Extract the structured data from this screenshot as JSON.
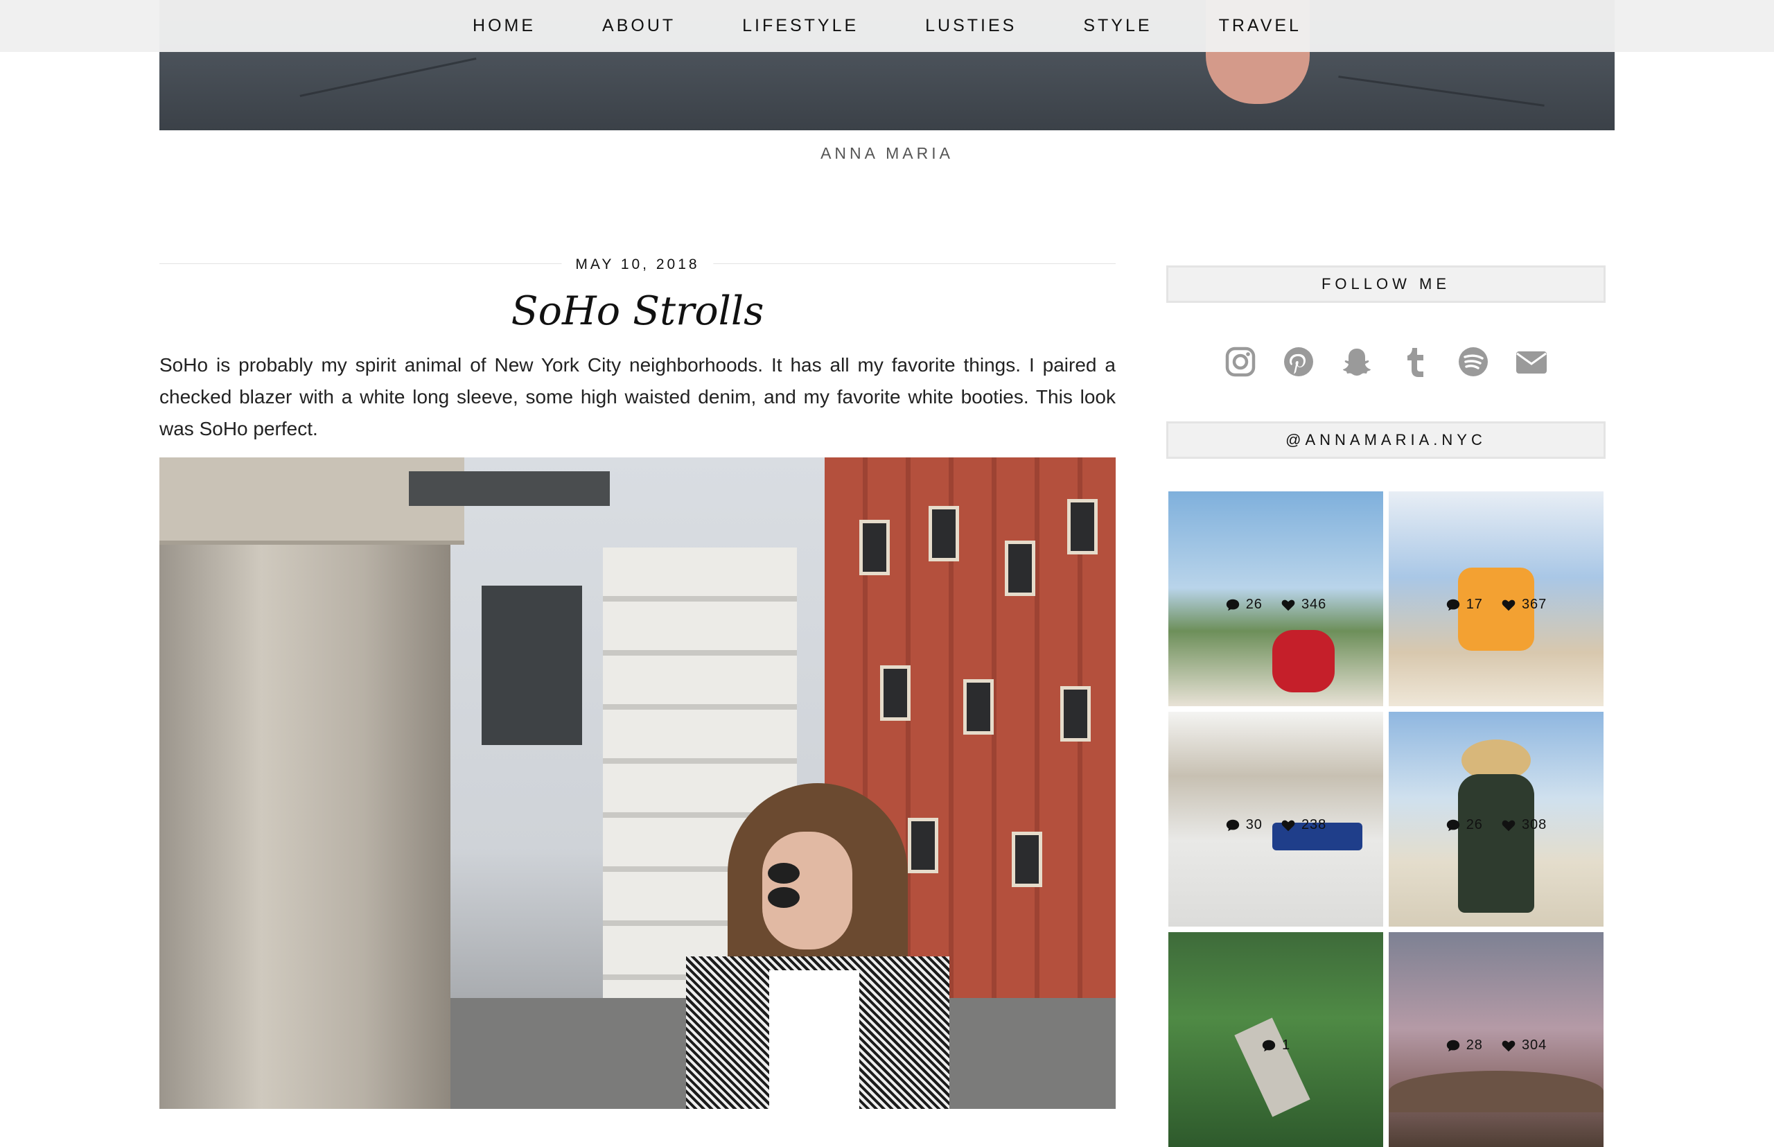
{
  "nav": {
    "items": [
      "HOME",
      "ABOUT",
      "LIFESTYLE",
      "LUSTIES",
      "STYLE",
      "TRAVEL"
    ]
  },
  "site": {
    "name": "ANNA MARIA"
  },
  "post": {
    "date": "MAY 10, 2018",
    "title": "SoHo Strolls",
    "body": "SoHo is probably my spirit animal of New York City neighborhoods. It has all my favorite things. I paired a checked blazer with a white long sleeve, some high waisted denim, and my favorite white booties. This look was SoHo perfect."
  },
  "sidebar": {
    "follow_title": "FOLLOW ME",
    "social_icons": [
      "instagram-icon",
      "pinterest-icon",
      "snapchat-icon",
      "tumblr-icon",
      "spotify-icon",
      "email-icon"
    ],
    "instagram_title": "@ANNAMARIA.NYC",
    "instagram_posts": [
      {
        "comments": "26",
        "likes": "346"
      },
      {
        "comments": "17",
        "likes": "367"
      },
      {
        "comments": "30",
        "likes": "238"
      },
      {
        "comments": "26",
        "likes": "308"
      },
      {
        "comments": "1",
        "likes": ""
      },
      {
        "comments": "28",
        "likes": "304"
      }
    ]
  },
  "colors": {
    "nav_bg": "#f0f0f0",
    "widget_bg": "#f1f1f1",
    "icon_gray": "#9a9a9a"
  }
}
